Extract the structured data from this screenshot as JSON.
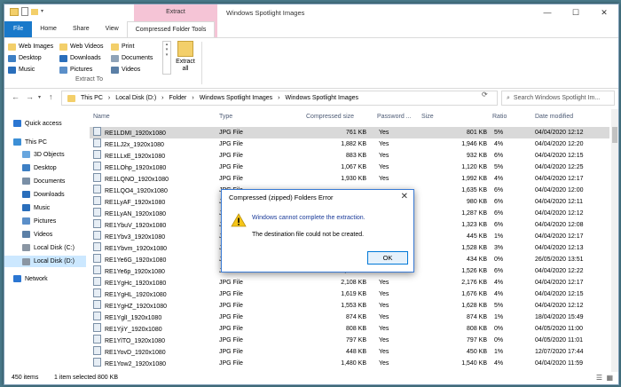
{
  "window": {
    "title": "Windows Spotlight Images",
    "context_tab": "Extract",
    "controls": [
      "—",
      "☐",
      "✕"
    ]
  },
  "tabs": [
    "File",
    "Home",
    "Share",
    "View",
    "Compressed Folder Tools"
  ],
  "ribbon": {
    "quick": [
      "Web Images",
      "Web Videos",
      "Print",
      "Desktop",
      "Downloads",
      "Documents",
      "Music",
      "Pictures",
      "Videos"
    ],
    "extract_all": "Extract all",
    "group_label": "Extract To"
  },
  "address": {
    "path": [
      "This PC",
      "Local Disk (D:)",
      "Folder",
      "Windows Spotlight Images",
      "Windows Spotlight Images"
    ],
    "search_placeholder": "Search Windows Spotlight Im..."
  },
  "nav": [
    {
      "label": "Quick access",
      "icon": "star-icon",
      "color": "#2b76d2"
    },
    {
      "label": "This PC",
      "icon": "computer-icon",
      "color": "#3c8fd6"
    },
    {
      "label": "3D Objects",
      "icon": "cube-icon",
      "color": "#68a6de"
    },
    {
      "label": "Desktop",
      "icon": "desktop-icon",
      "color": "#3d7fc4"
    },
    {
      "label": "Documents",
      "icon": "documents-icon",
      "color": "#7a8fa6"
    },
    {
      "label": "Downloads",
      "icon": "downloads-icon",
      "color": "#2a6ebb"
    },
    {
      "label": "Music",
      "icon": "music-icon",
      "color": "#2a6ebb"
    },
    {
      "label": "Pictures",
      "icon": "pictures-icon",
      "color": "#5b8fc9"
    },
    {
      "label": "Videos",
      "icon": "videos-icon",
      "color": "#5b7fa6"
    },
    {
      "label": "Local Disk (C:)",
      "icon": "disk-icon",
      "color": "#8a96a3"
    },
    {
      "label": "Local Disk (D:)",
      "icon": "disk-icon",
      "color": "#8a96a3"
    },
    {
      "label": "Network",
      "icon": "network-icon",
      "color": "#2b76d2"
    }
  ],
  "columns": [
    "Name",
    "Type",
    "Compressed size",
    "Password ...",
    "Size",
    "Ratio",
    "Date modified"
  ],
  "rows": [
    {
      "name": "RE1LDMI_1920x1080",
      "type": "JPG File",
      "csize": "761 KB",
      "pw": "Yes",
      "size": "801 KB",
      "ratio": "5%",
      "date": "04/04/2020 12:12"
    },
    {
      "name": "RE1LJ2x_1920x1080",
      "type": "JPG File",
      "csize": "1,882 KB",
      "pw": "Yes",
      "size": "1,946 KB",
      "ratio": "4%",
      "date": "04/04/2020 12:20"
    },
    {
      "name": "RE1LLxE_1920x1080",
      "type": "JPG File",
      "csize": "883 KB",
      "pw": "Yes",
      "size": "932 KB",
      "ratio": "6%",
      "date": "04/04/2020 12:15"
    },
    {
      "name": "RE1LOhp_1920x1080",
      "type": "JPG File",
      "csize": "1,067 KB",
      "pw": "Yes",
      "size": "1,120 KB",
      "ratio": "5%",
      "date": "04/04/2020 12:25"
    },
    {
      "name": "RE1LQNO_1920x1080",
      "type": "JPG File",
      "csize": "1,930 KB",
      "pw": "Yes",
      "size": "1,992 KB",
      "ratio": "4%",
      "date": "04/04/2020 12:17"
    },
    {
      "name": "RE1LQO4_1920x1080",
      "type": "JPG File",
      "csize": "",
      "pw": "",
      "size": "1,635 KB",
      "ratio": "6%",
      "date": "04/04/2020 12:00"
    },
    {
      "name": "RE1LyAF_1920x1080",
      "type": "JPG File",
      "csize": "",
      "pw": "",
      "size": "980 KB",
      "ratio": "6%",
      "date": "04/04/2020 12:11"
    },
    {
      "name": "RE1LyAN_1920x1080",
      "type": "JPG File",
      "csize": "",
      "pw": "",
      "size": "1,287 KB",
      "ratio": "6%",
      "date": "04/04/2020 12:12"
    },
    {
      "name": "RE1YbuV_1920x1080",
      "type": "JPG File",
      "csize": "",
      "pw": "",
      "size": "1,323 KB",
      "ratio": "6%",
      "date": "04/04/2020 12:08"
    },
    {
      "name": "RE1Ybv3_1920x1080",
      "type": "JPG File",
      "csize": "",
      "pw": "",
      "size": "445 KB",
      "ratio": "1%",
      "date": "04/04/2020 12:17"
    },
    {
      "name": "RE1Ybvm_1920x1080",
      "type": "JPG File",
      "csize": "",
      "pw": "",
      "size": "1,528 KB",
      "ratio": "3%",
      "date": "04/04/2020 12:13"
    },
    {
      "name": "RE1Ye6G_1920x1080",
      "type": "JPG File",
      "csize": "",
      "pw": "",
      "size": "434 KB",
      "ratio": "0%",
      "date": "26/05/2020 13:51"
    },
    {
      "name": "RE1Ye6p_1920x1080",
      "type": "JPG File",
      "csize": "1,447 KB",
      "pw": "Yes",
      "size": "1,526 KB",
      "ratio": "6%",
      "date": "04/04/2020 12:22"
    },
    {
      "name": "RE1YgHc_1920x1080",
      "type": "JPG File",
      "csize": "2,108 KB",
      "pw": "Yes",
      "size": "2,176 KB",
      "ratio": "4%",
      "date": "04/04/2020 12:17"
    },
    {
      "name": "RE1YgHL_1920x1080",
      "type": "JPG File",
      "csize": "1,619 KB",
      "pw": "Yes",
      "size": "1,676 KB",
      "ratio": "4%",
      "date": "04/04/2020 12:15"
    },
    {
      "name": "RE1YgHZ_1920x1080",
      "type": "JPG File",
      "csize": "1,553 KB",
      "pw": "Yes",
      "size": "1,628 KB",
      "ratio": "5%",
      "date": "04/04/2020 12:12"
    },
    {
      "name": "RE1YglI_1920x1080",
      "type": "JPG File",
      "csize": "874 KB",
      "pw": "Yes",
      "size": "874 KB",
      "ratio": "1%",
      "date": "18/04/2020 15:49"
    },
    {
      "name": "RE1YjiY_1920x1080",
      "type": "JPG File",
      "csize": "808 KB",
      "pw": "Yes",
      "size": "808 KB",
      "ratio": "0%",
      "date": "04/05/2020 11:00"
    },
    {
      "name": "RE1YlTO_1920x1080",
      "type": "JPG File",
      "csize": "797 KB",
      "pw": "Yes",
      "size": "797 KB",
      "ratio": "0%",
      "date": "04/05/2020 11:01"
    },
    {
      "name": "RE1YovD_1920x1080",
      "type": "JPG File",
      "csize": "448 KB",
      "pw": "Yes",
      "size": "450 KB",
      "ratio": "1%",
      "date": "12/07/2020 17:44"
    },
    {
      "name": "RE1Yow2_1920x1080",
      "type": "JPG File",
      "csize": "1,480 KB",
      "pw": "Yes",
      "size": "1,540 KB",
      "ratio": "4%",
      "date": "04/04/2020 11:59"
    }
  ],
  "status": {
    "count": "450 items",
    "selected": "1 item selected  800 KB"
  },
  "dialog": {
    "title": "Compressed (zipped) Folders Error",
    "message": "Windows cannot complete the extraction.",
    "detail": "The destination file could not be created.",
    "ok": "OK"
  }
}
